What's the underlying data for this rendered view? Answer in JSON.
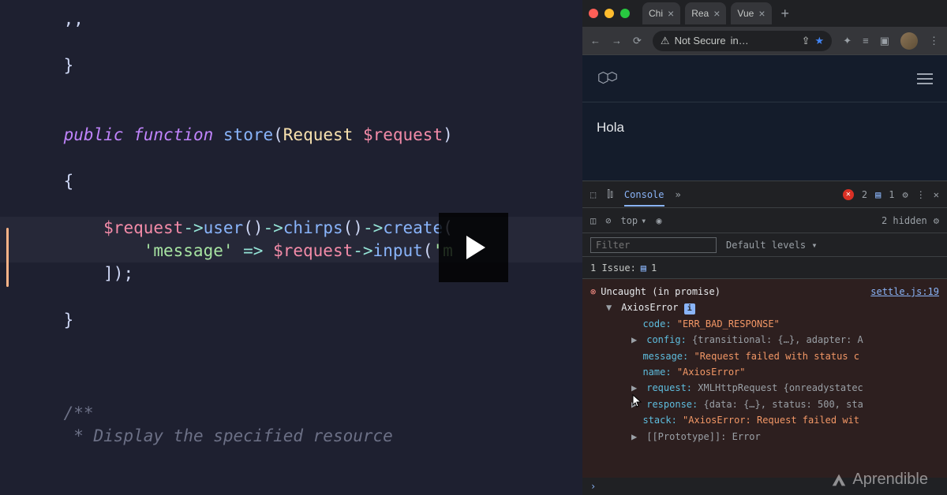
{
  "editor": {
    "l1": "    ,,",
    "brace_close": "}",
    "sig": {
      "pub": "public",
      "fn": "function",
      "name": "store",
      "open": "(",
      "type": "Request",
      "var": "$request",
      "close": ")"
    },
    "brace_open": "{",
    "call": {
      "var": "$request",
      "arrow1": "->",
      "m1": "user",
      "p1": "()",
      "arrow2": "->",
      "m2": "chirps",
      "p2": "()",
      "arrow3": "->",
      "m3": "create",
      "p3": "("
    },
    "arr": {
      "key": "'message'",
      "fat": " => ",
      "var": "$request",
      "arrow": "->",
      "m": "input",
      "open": "(",
      "arg": "'m"
    },
    "arr_close": "]);",
    "comment_open": "/**",
    "comment_line": " * Display the specified resource"
  },
  "browser": {
    "tabs": [
      {
        "label": "Chi"
      },
      {
        "label": "Rea"
      },
      {
        "label": "Vue"
      }
    ],
    "addr": {
      "secure": "Not Secure",
      "url": "in…"
    },
    "page": {
      "greeting": "Hola"
    }
  },
  "devtools": {
    "active_tab": "Console",
    "more": "»",
    "error_count": "2",
    "info_count": "1",
    "context": "top",
    "hidden": "2 hidden",
    "filter_placeholder": "Filter",
    "levels": "Default levels ▾",
    "issues": {
      "label": "1 Issue:",
      "count": "1"
    },
    "error": {
      "title": "Uncaught (in promise)",
      "source": "settle.js:19",
      "obj_name": "AxiosError",
      "props": {
        "code_k": "code:",
        "code_v": "\"ERR_BAD_RESPONSE\"",
        "config_k": "config:",
        "config_v": "{transitional: {…}, adapter: A",
        "message_k": "message:",
        "message_v": "\"Request failed with status c",
        "name_k": "name:",
        "name_v": "\"AxiosError\"",
        "request_k": "request:",
        "request_v": "XMLHttpRequest {onreadystatec",
        "response_k": "response:",
        "response_v": "{data: {…}, status: 500, sta",
        "stack_k": "stack:",
        "stack_v": "\"AxiosError: Request failed wit",
        "proto_k": "[[Prototype]]:",
        "proto_v": "Error"
      }
    }
  },
  "watermark": "Aprendible"
}
